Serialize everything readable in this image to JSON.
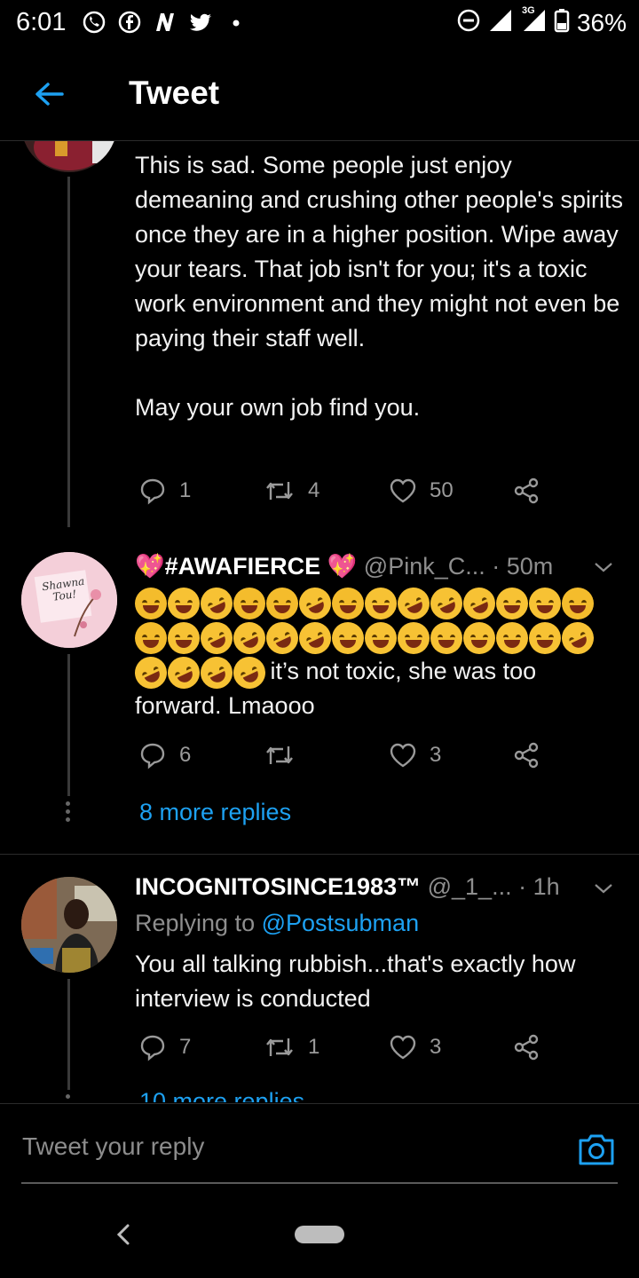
{
  "status_bar": {
    "time": "6:01",
    "network": "3G",
    "battery": "36%",
    "icons": [
      "whatsapp-icon",
      "facebook-icon",
      "news-icon",
      "twitter-icon",
      "dot-icon",
      "dnd-icon",
      "signal-icon",
      "battery-icon"
    ]
  },
  "header": {
    "title": "Tweet",
    "back_icon": "arrow-left-icon"
  },
  "tweets": [
    {
      "text": "This is sad. Some people just enjoy demeaning and crushing other people's spirits once they are in a higher position. Wipe away your tears. That job isn't for you; it's a toxic work environment and they might not even be paying their staff well.\n\nMay your own job find you.",
      "replies": "1",
      "retweets": "4",
      "likes": "50"
    },
    {
      "name": "💖#AWAFIERCE 💖",
      "handle": "@Pink_C...",
      "time": "· 50m",
      "avatar_text": "Shawna Tou!",
      "text_after_emoji": " it’s not toxic, she was too forward. Lmaooo",
      "replies": "6",
      "retweets": "",
      "likes": "3",
      "more_replies": "8 more replies"
    },
    {
      "name": "INCOGNITOSINCE1983™",
      "handle": "@_1_...",
      "time": "· 1h",
      "replying_prefix": "Replying to ",
      "replying_to": "@Postsubman",
      "text": "You all talking rubbish...that's exactly how interview is conducted",
      "replies": "7",
      "retweets": "1",
      "likes": "3",
      "more_replies": "10 more replies"
    }
  ],
  "composer": {
    "placeholder": "Tweet your reply",
    "camera_icon": "camera-icon"
  },
  "colors": {
    "accent": "#1da1f2",
    "background": "#000000",
    "muted": "#8e8e8e"
  }
}
